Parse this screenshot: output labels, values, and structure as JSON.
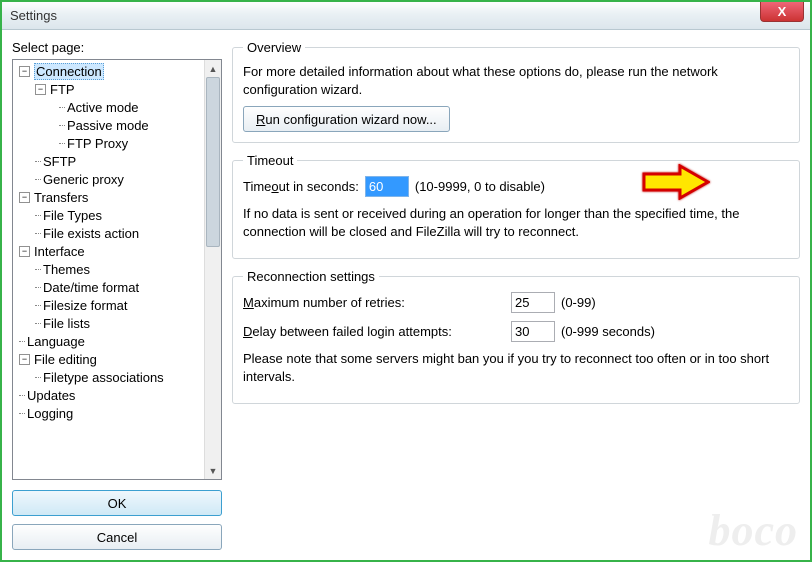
{
  "window": {
    "title": "Settings",
    "close": "X"
  },
  "left": {
    "select_page": "Select page:",
    "ok": "OK",
    "cancel": "Cancel"
  },
  "tree": {
    "connection": "Connection",
    "ftp": "FTP",
    "active_mode": "Active mode",
    "passive_mode": "Passive mode",
    "ftp_proxy": "FTP Proxy",
    "sftp": "SFTP",
    "generic_proxy": "Generic proxy",
    "transfers": "Transfers",
    "file_types": "File Types",
    "file_exists": "File exists action",
    "interface": "Interface",
    "themes": "Themes",
    "datetime": "Date/time format",
    "filesize": "Filesize format",
    "filelists": "File lists",
    "language": "Language",
    "file_editing": "File editing",
    "filetype_assoc": "Filetype associations",
    "updates": "Updates",
    "logging": "Logging"
  },
  "overview": {
    "legend": "Overview",
    "desc": "For more detailed information about what these options do, please run the network configuration wizard.",
    "btn_prefix": "R",
    "btn_rest": "un configuration wizard now..."
  },
  "timeout": {
    "legend": "Timeout",
    "label_prefix": "Time",
    "label_u": "o",
    "label_suffix": "ut in seconds:",
    "value": "60",
    "range": "(10-9999, 0 to disable)",
    "desc": "If no data is sent or received during an operation for longer than the specified time, the connection will be closed and FileZilla will try to reconnect."
  },
  "reconnect": {
    "legend": "Reconnection settings",
    "max_u": "M",
    "max_rest": "aximum number of retries:",
    "max_value": "25",
    "max_range": "(0-99)",
    "delay_u": "D",
    "delay_rest": "elay between failed login attempts:",
    "delay_value": "30",
    "delay_range": "(0-999 seconds)",
    "note": "Please note that some servers might ban you if you try to reconnect too often or in too short intervals."
  },
  "watermark": "boco"
}
